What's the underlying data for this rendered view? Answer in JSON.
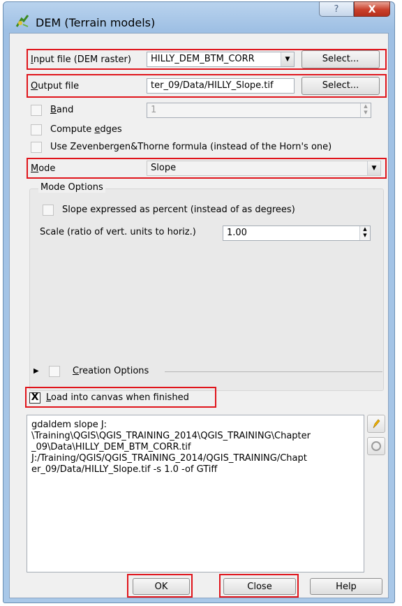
{
  "window": {
    "title": "DEM (Terrain models)",
    "help_glyph": "?",
    "close_glyph": "X"
  },
  "input": {
    "label_u": "I",
    "label_rest": "nput file (DEM raster)",
    "value": "HILLY_DEM_BTM_CORR",
    "select_label": "Select..."
  },
  "output": {
    "label_u": "O",
    "label_rest": "utput file",
    "value": "ter_09/Data/HILLY_Slope.tif",
    "select_label": "Select..."
  },
  "band": {
    "label_u": "B",
    "label_rest": "and",
    "value": "1"
  },
  "compute_edges": {
    "label_pre": "Compute ",
    "label_u": "e",
    "label_rest": "dges"
  },
  "zevenbergen": {
    "label": "Use Zevenbergen&Thorne formula (instead of the Horn's one)"
  },
  "mode": {
    "label_u": "M",
    "label_rest": "ode",
    "value": "Slope"
  },
  "mode_options": {
    "title": "Mode Options",
    "slope_percent": "Slope expressed as percent (instead of as degrees)",
    "scale_label": "Scale (ratio of vert. units to horiz.)",
    "scale_value": "1.00"
  },
  "creation_options": {
    "label_u": "C",
    "label_rest": "reation Options"
  },
  "load_canvas": {
    "check_glyph": "X",
    "label_u": "L",
    "label_rest": "oad into canvas when finished"
  },
  "command": {
    "lines": [
      "gdaldem slope J:",
      "\\Training\\QGIS\\QGIS_TRAINING_2014\\QGIS_TRAINING\\Chapter",
      "_09\\Data\\HILLY_DEM_BTM_CORR.tif",
      "J:/Training/QGIS/QGIS_TRAINING_2014/QGIS_TRAINING/Chapt",
      "er_09/Data/HILLY_Slope.tif -s 1.0 -of GTiff"
    ]
  },
  "buttons": {
    "ok": "OK",
    "close": "Close",
    "help": "Help"
  },
  "colors": {
    "highlight": "#e0141b",
    "title_bg": "#a9c8e8",
    "dialog_bg": "#f0f0f0"
  }
}
